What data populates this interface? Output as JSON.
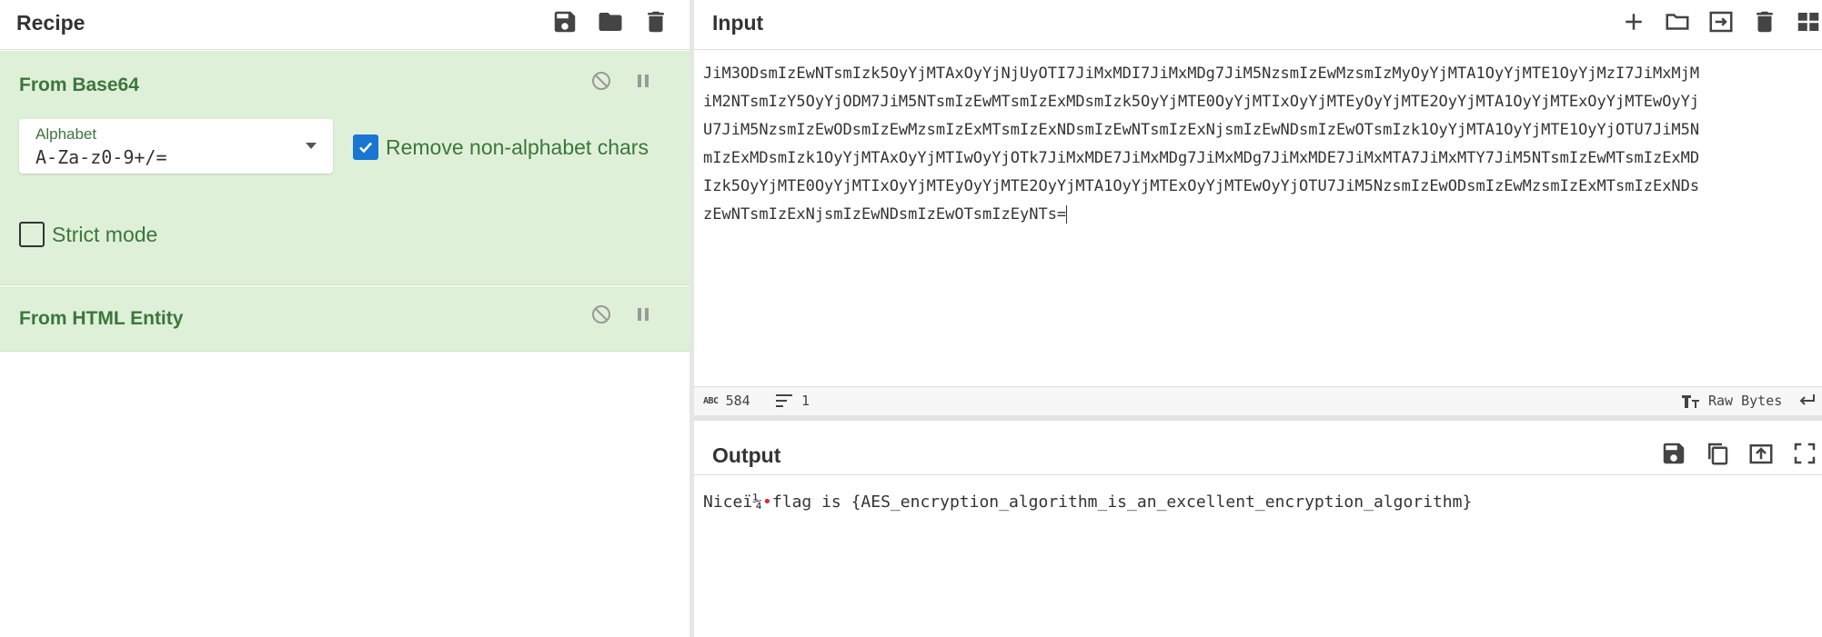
{
  "recipe": {
    "title": "Recipe",
    "icons": [
      "save-icon",
      "folder-icon",
      "trash-icon"
    ],
    "operations": [
      {
        "name": "From Base64",
        "alphabet_label": "Alphabet",
        "alphabet_value": "A-Za-z0-9+/=",
        "remove_non_alphabet_label": "Remove non-alphabet chars",
        "remove_non_alphabet_checked": true,
        "strict_mode_label": "Strict mode",
        "strict_mode_checked": false
      },
      {
        "name": "From HTML Entity"
      }
    ]
  },
  "input": {
    "title": "Input",
    "icons": [
      "plus-icon",
      "folder-icon",
      "import-icon",
      "trash-icon",
      "layout-icon"
    ],
    "lines": [
      "JiM3ODsmIzEwNTsmIzk5OyYjMTAxOyYjNjUyOTI7JiMxMDI7JiMxMDg7JiM5NzsmIzEwMzsmIzMyOyYjMTA1OyYjMTE1OyYjMzI7JiMxMjM",
      "iM2NTsmIzY5OyYjODM7JiM5NTsmIzEwMTsmIzExMDsmIzk5OyYjMTE0OyYjMTIxOyYjMTEyOyYjMTE2OyYjMTA1OyYjMTExOyYjMTEwOyYj",
      "U7JiM5NzsmIzEwODsmIzEwMzsmIzExMTsmIzExNDsmIzEwNTsmIzExNjsmIzEwNDsmIzEwOTsmIzk1OyYjMTA1OyYjMTE1OyYjOTU7JiM5N",
      "mIzExMDsmIzk1OyYjMTAxOyYjMTIwOyYjOTk7JiMxMDE7JiMxMDg7JiMxMDg7JiMxMDE7JiMxMTA7JiMxMTY7JiM5NTsmIzEwMTsmIzExMD",
      "Izk5OyYjMTE0OyYjMTIxOyYjMTEyOyYjMTE2OyYjMTA1OyYjMTExOyYjMTEwOyYjOTU7JiM5NzsmIzEwODsmIzEwMzsmIzExMTsmIzExNDs",
      "zEwNTsmIzExNjsmIzEwNDsmIzEwOTsmIzEyNTs="
    ],
    "status": {
      "char_count": "584",
      "line_count": "1",
      "encoding": "Raw Bytes"
    }
  },
  "output": {
    "title": "Output",
    "icons": [
      "save-icon",
      "copy-icon",
      "replace-input-icon",
      "maximize-icon"
    ],
    "text_before": "Nice",
    "garbled": "ï¼",
    "text_after": "flag is {AES_encryption_algorithm_is_an_excellent_encryption_algorithm}"
  },
  "colors": {
    "op_background": "#dff0d8",
    "op_text": "#3c763d",
    "checkbox_on": "#1976d2",
    "control_char": "#d32f2f"
  }
}
